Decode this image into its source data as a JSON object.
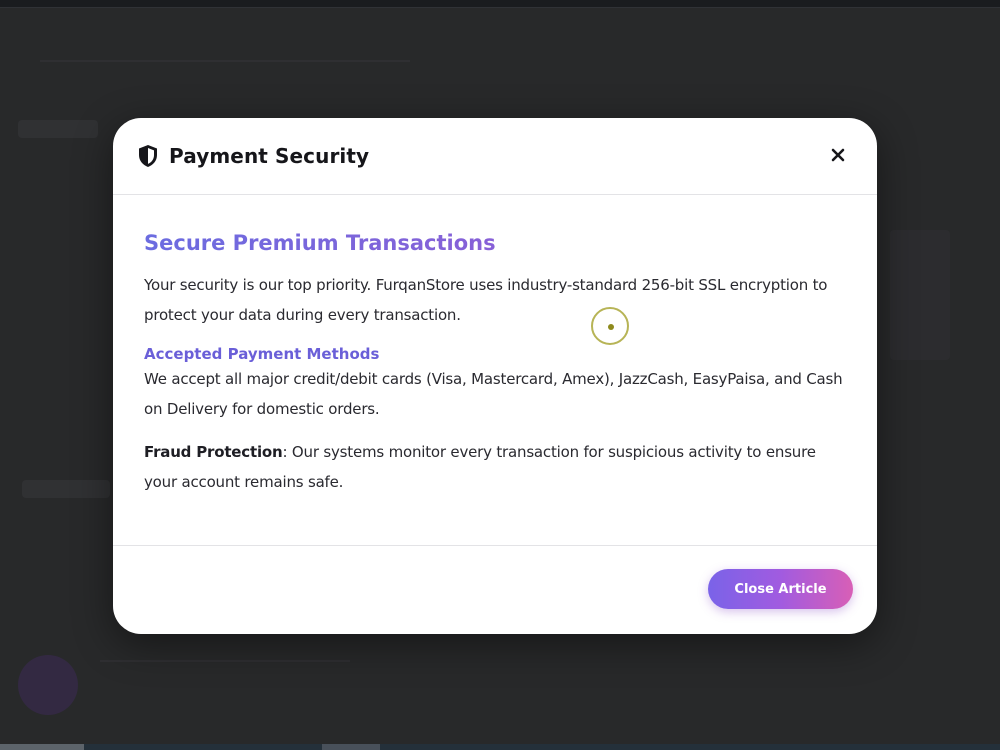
{
  "modal": {
    "title": "Payment Security",
    "header_icon": "shield-icon",
    "close_icon": "close-icon",
    "section_title": "Secure Premium Transactions",
    "intro": "Your security is our top priority. FurqanStore uses industry-standard 256-bit SSL encryption to protect your data during every transaction.",
    "payment_methods_heading": "Accepted Payment Methods",
    "payment_methods_text": "We accept all major credit/debit cards (Visa, Mastercard, Amex), JazzCash, EasyPaisa, and Cash on Delivery for domestic orders.",
    "fraud_label": "Fraud Protection",
    "fraud_text": ": Our systems monitor every transaction for suspicious activity to ensure your account remains safe.",
    "close_button_label": "Close Article"
  },
  "colors": {
    "accent_start": "#7a63e8",
    "accent_end": "#d85fb6",
    "heading_purple": "#6a5fd8"
  }
}
